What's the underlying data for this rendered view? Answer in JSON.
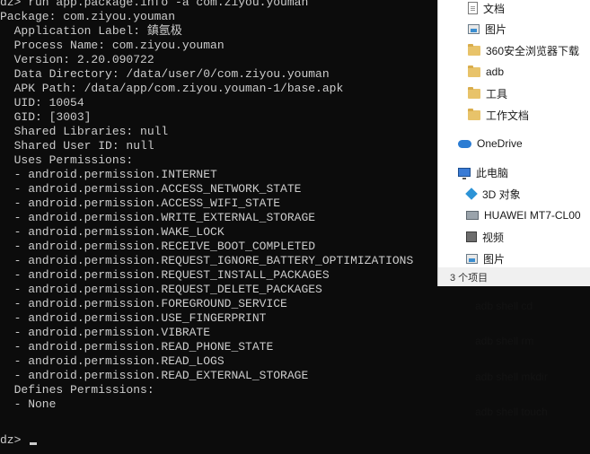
{
  "terminal": {
    "lines": [
      "dz> run app.package.info -a com.ziyou.youman",
      "Package: com.ziyou.youman",
      "  Application Label: 鎮氬极",
      "  Process Name: com.ziyou.youman",
      "  Version: 2.20.090722",
      "  Data Directory: /data/user/0/com.ziyou.youman",
      "  APK Path: /data/app/com.ziyou.youman-1/base.apk",
      "  UID: 10054",
      "  GID: [3003]",
      "  Shared Libraries: null",
      "  Shared User ID: null",
      "  Uses Permissions:",
      "  - android.permission.INTERNET",
      "  - android.permission.ACCESS_NETWORK_STATE",
      "  - android.permission.ACCESS_WIFI_STATE",
      "  - android.permission.WRITE_EXTERNAL_STORAGE",
      "  - android.permission.WAKE_LOCK",
      "  - android.permission.RECEIVE_BOOT_COMPLETED",
      "  - android.permission.REQUEST_IGNORE_BATTERY_OPTIMIZATIONS",
      "  - android.permission.REQUEST_INSTALL_PACKAGES",
      "  - android.permission.REQUEST_DELETE_PACKAGES",
      "  - android.permission.FOREGROUND_SERVICE",
      "  - android.permission.USE_FINGERPRINT",
      "  - android.permission.VIBRATE",
      "  - android.permission.READ_PHONE_STATE",
      "  - android.permission.READ_LOGS",
      "  - android.permission.READ_EXTERNAL_STORAGE",
      "  Defines Permissions:",
      "  - None"
    ],
    "prompt": "dz> "
  },
  "explorer": {
    "nav_items": [
      {
        "label": "文档",
        "icon": "document-icon"
      },
      {
        "label": "图片",
        "icon": "pictures-icon"
      },
      {
        "label": "360安全浏览器下载",
        "icon": "folder-icon"
      },
      {
        "label": "adb",
        "icon": "folder-icon"
      },
      {
        "label": "工具",
        "icon": "folder-icon"
      },
      {
        "label": "工作文档",
        "icon": "folder-icon"
      },
      {
        "label": "OneDrive",
        "icon": "onedrive-icon"
      },
      {
        "label": "此电脑",
        "icon": "this-pc-icon"
      },
      {
        "label": "3D 对象",
        "icon": "3d-objects-icon"
      },
      {
        "label": "HUAWEI MT7-CL00",
        "icon": "device-icon"
      },
      {
        "label": "视频",
        "icon": "videos-icon"
      },
      {
        "label": "图片",
        "icon": "pictures-icon"
      }
    ],
    "status": "3 个项目"
  },
  "background_items": [
    "adb shell cd",
    "adb shell rm",
    "adb shell mkdir",
    "adb shell touch"
  ]
}
